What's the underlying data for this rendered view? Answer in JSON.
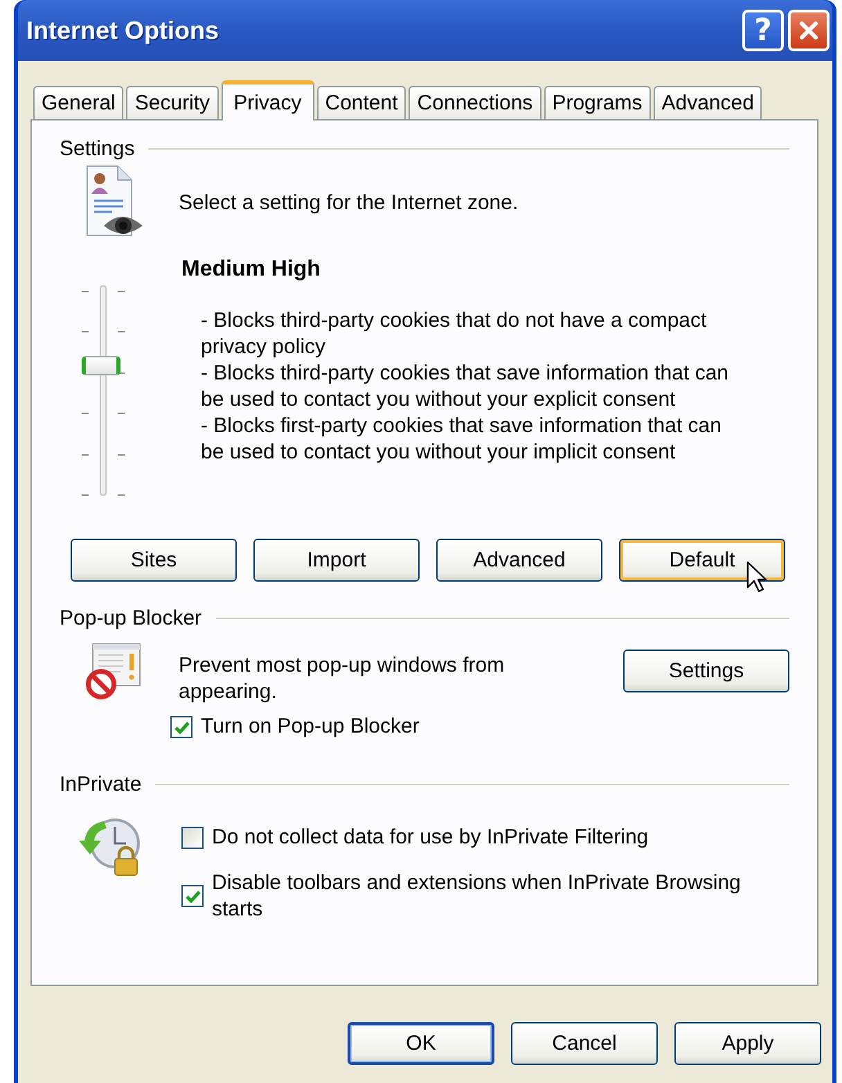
{
  "window": {
    "title": "Internet Options",
    "help": "?"
  },
  "tabs": [
    {
      "label": "General",
      "selected": false
    },
    {
      "label": "Security",
      "selected": false
    },
    {
      "label": "Privacy",
      "selected": true
    },
    {
      "label": "Content",
      "selected": false
    },
    {
      "label": "Connections",
      "selected": false
    },
    {
      "label": "Programs",
      "selected": false
    },
    {
      "label": "Advanced",
      "selected": false
    }
  ],
  "settings": {
    "heading": "Settings",
    "prompt": "Select a setting for the Internet zone.",
    "slider": {
      "level": 0.6
    },
    "level_name": "Medium High",
    "description": [
      "- Blocks third-party cookies that do not have a compact privacy policy",
      "- Blocks third-party cookies that save information that can be used to contact you without your explicit consent",
      "- Blocks first-party cookies that save information that can be used to contact you without your implicit consent"
    ],
    "buttons": [
      {
        "label": "Sites",
        "hot": false
      },
      {
        "label": "Import",
        "hot": false
      },
      {
        "label": "Advanced",
        "hot": false
      },
      {
        "label": "Default",
        "hot": true
      }
    ]
  },
  "popup_blocker": {
    "heading": "Pop-up Blocker",
    "description": "Prevent most pop-up windows from appearing.",
    "button": "Settings",
    "checkbox": {
      "label": "Turn on Pop-up Blocker",
      "checked": true
    }
  },
  "inprivate": {
    "heading": "InPrivate",
    "checkboxes": [
      {
        "label": "Do not collect data for use by InPrivate Filtering",
        "checked": false
      },
      {
        "label": "Disable toolbars and extensions when InPrivate Browsing starts",
        "checked": true
      }
    ]
  },
  "buttons": [
    {
      "label": "OK",
      "default": true
    },
    {
      "label": "Cancel",
      "default": false
    },
    {
      "label": "Apply",
      "default": false
    }
  ]
}
